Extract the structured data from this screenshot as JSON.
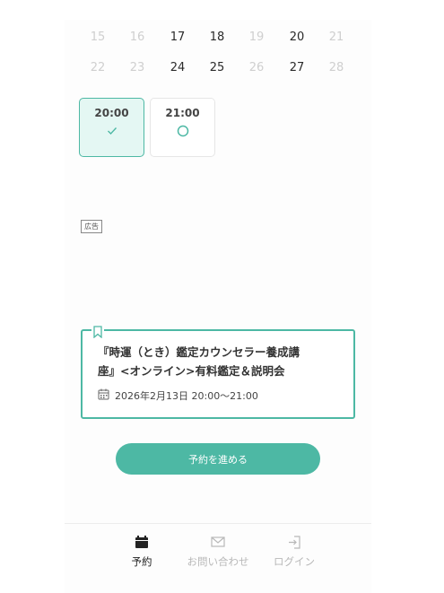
{
  "calendar": {
    "week1": [
      {
        "d": "15",
        "state": "disabled"
      },
      {
        "d": "16",
        "state": "disabled"
      },
      {
        "d": "17",
        "state": "enabled"
      },
      {
        "d": "18",
        "state": "enabled"
      },
      {
        "d": "19",
        "state": "disabled"
      },
      {
        "d": "20",
        "state": "enabled"
      },
      {
        "d": "21",
        "state": "disabled"
      }
    ],
    "week2": [
      {
        "d": "22",
        "state": "disabled"
      },
      {
        "d": "23",
        "state": "disabled"
      },
      {
        "d": "24",
        "state": "enabled"
      },
      {
        "d": "25",
        "state": "enabled"
      },
      {
        "d": "26",
        "state": "disabled"
      },
      {
        "d": "27",
        "state": "enabled"
      },
      {
        "d": "28",
        "state": "disabled"
      }
    ]
  },
  "slots": [
    {
      "time": "20:00",
      "state": "selected",
      "icon": "check-icon"
    },
    {
      "time": "21:00",
      "state": "available",
      "icon": "circle-icon"
    }
  ],
  "ad": {
    "label": "広告"
  },
  "event": {
    "title_line1": "『時運（とき）鑑定カウンセラー養成講",
    "title_line2": "座』<オンライン>有料鑑定＆説明会",
    "datetime": "2026年2月13日 20:00〜21:00"
  },
  "proceed_button": {
    "label": "予約を進める"
  },
  "nav": [
    {
      "label": "予約",
      "icon": "calendar-icon",
      "active": true
    },
    {
      "label": "お問い合わせ",
      "icon": "mail-icon",
      "active": false
    },
    {
      "label": "ログイン",
      "icon": "login-icon",
      "active": false
    }
  ],
  "colors": {
    "accent": "#4db8a4",
    "selected_bg": "#e4f7f3",
    "disabled_text": "#cfcfcf"
  }
}
